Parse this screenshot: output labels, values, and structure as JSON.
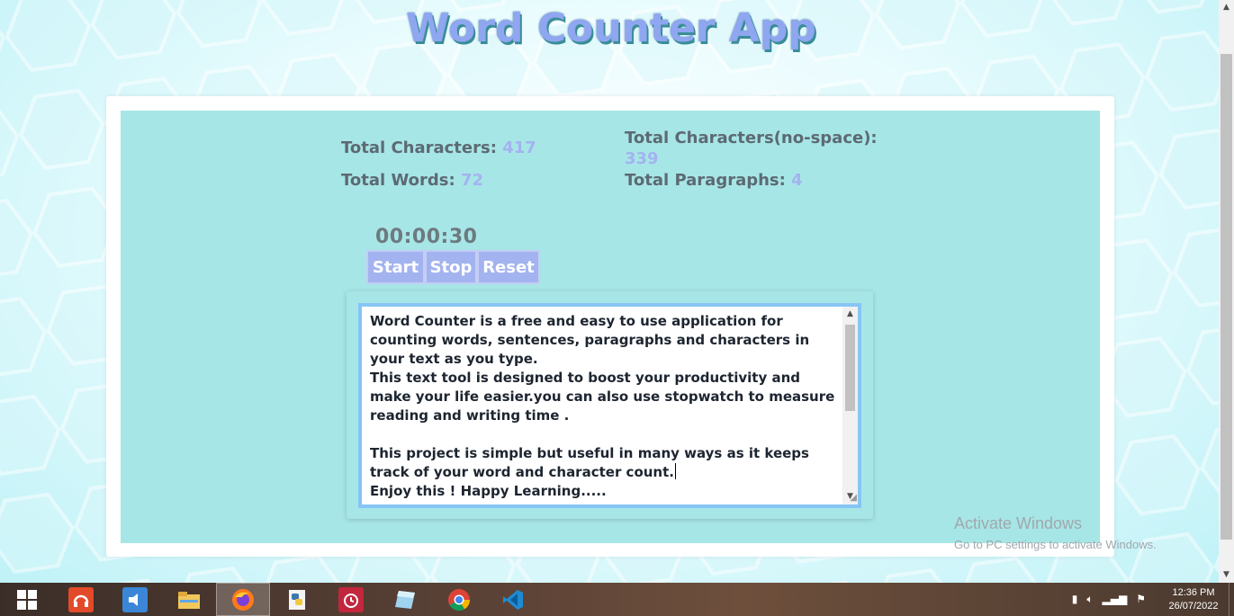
{
  "app": {
    "title": "Word Counter App"
  },
  "stats": {
    "total_characters_label": "Total Characters:",
    "total_characters_value": "417",
    "total_characters_nospace_label": "Total Characters(no-space):",
    "total_characters_nospace_value": "339",
    "total_words_label": "Total Words:",
    "total_words_value": "72",
    "total_paragraphs_label": "Total Paragraphs:",
    "total_paragraphs_value": "4"
  },
  "stopwatch": {
    "time": "00:00:30",
    "start_label": "Start",
    "stop_label": "Stop",
    "reset_label": "Reset"
  },
  "editor": {
    "text": "Word Counter is a free and easy to use application for counting words, sentences, paragraphs and characters in your text as you type.\nThis text tool is designed to boost your productivity and make your life easier.you can also use stopwatch to measure reading and writing time .\n\nThis project is simple but useful in many ways as it keeps track of your word and character count.",
    "text_after_caret": "\nEnjoy this ! Happy Learning....."
  },
  "watermark": {
    "line1": "Activate Windows",
    "line2": "Go to PC settings to activate Windows."
  },
  "taskbar": {
    "items": [
      {
        "icon": "windows-start-icon"
      },
      {
        "icon": "headphones-icon"
      },
      {
        "icon": "volume-app-icon"
      },
      {
        "icon": "file-explorer-icon"
      },
      {
        "icon": "firefox-icon",
        "active": true
      },
      {
        "icon": "python-icon"
      },
      {
        "icon": "alarm-clock-icon"
      },
      {
        "icon": "notepad-icon"
      },
      {
        "icon": "chrome-icon"
      },
      {
        "icon": "vscode-icon"
      }
    ],
    "clock_time": "12:36 PM",
    "clock_date": "26/07/2022"
  },
  "colors": {
    "accent": "#a3b3f0",
    "panel": "#a7e6e6",
    "title": "#8fa6f0"
  }
}
